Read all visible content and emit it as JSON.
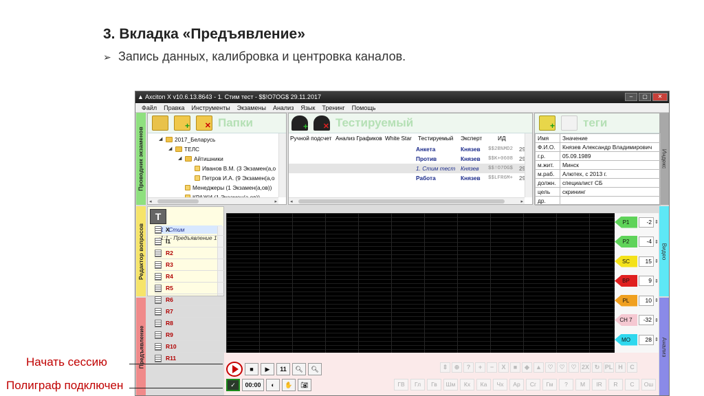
{
  "slide": {
    "title": "3. Вкладка «Предъявление»",
    "bullet": "Запись данных, калибровка и центровка каналов.",
    "bullet_marker": "➢"
  },
  "window": {
    "title": "Axciton X v10.6.13.8643 - 1. Стим тест - $$!O7OG$ 29.11.2017"
  },
  "menu": [
    "Файл",
    "Правка",
    "Инструменты",
    "Экзамены",
    "Анализ",
    "Язык",
    "Тренинг",
    "Помощь"
  ],
  "side_tabs": {
    "explorer": "Проводник экзаменов",
    "editor": "Редактор вопросов",
    "presentation": "Предъявление",
    "index": "Индекс",
    "video": "Видео",
    "analysis": "Анализ"
  },
  "folders_panel": {
    "title": "Папки",
    "tree": [
      {
        "label": "2017_Беларусь"
      },
      {
        "label": "ТЕЛС"
      },
      {
        "label": "Айтишники"
      },
      {
        "label": "Иванов В.М. (3 Экзамен(а,о"
      },
      {
        "label": "Петров И.А. (9 Экзамен(а,о"
      },
      {
        "label": "Менеджеры (1 Экзамен(а,ов))"
      },
      {
        "label": "КРАЖИ (1 Экзамен(а,ов))"
      }
    ]
  },
  "tested_panel": {
    "title": "Тестируемый",
    "columns": [
      "Ручной подсчет",
      "Анализ Графиков",
      "White Star",
      "Тестируемый",
      "Эксперт",
      "ИД"
    ],
    "rows": [
      {
        "name": "Анкета",
        "expert": "Князев",
        "id": "$$2B%MD2",
        "num": "29."
      },
      {
        "name": "Против",
        "expert": "Князев",
        "id": "$$K+0608",
        "num": "29."
      },
      {
        "name": "1. Стим тест",
        "expert": "Князев",
        "id": "$$!O7OG$",
        "num": "29."
      },
      {
        "name": "Работа",
        "expert": "Князев",
        "id": "$$LFR6M+",
        "num": "29."
      }
    ]
  },
  "tags_panel": {
    "title": "теги",
    "header": {
      "key": "Имя",
      "value": "Значение"
    },
    "rows": [
      {
        "key": "Ф.И.О.",
        "value": "Князев Александр Владимирович"
      },
      {
        "key": "г.р.",
        "value": "05.09.1989"
      },
      {
        "key": "м.жит.",
        "value": "Минск"
      },
      {
        "key": "м.раб.",
        "value": "Алютех, с 2013 г."
      },
      {
        "key": "должн.",
        "value": "специалист СБ"
      },
      {
        "key": "цель",
        "value": "скрининг"
      },
      {
        "key": "др.",
        "value": ""
      }
    ]
  },
  "question_editor": {
    "items": [
      "1 - Стим",
      "1:1 - Предъявление 1"
    ],
    "questions": [
      {
        "label": "X",
        "color": "#111111"
      },
      {
        "label": "I1",
        "color": "#111111"
      },
      {
        "label": "R2",
        "color": "#b00000"
      },
      {
        "label": "R3",
        "color": "#b00000"
      },
      {
        "label": "R4",
        "color": "#b00000"
      },
      {
        "label": "R5",
        "color": "#b00000"
      },
      {
        "label": "R6",
        "color": "#b00000"
      },
      {
        "label": "R7",
        "color": "#b00000"
      },
      {
        "label": "R8",
        "color": "#b00000"
      },
      {
        "label": "R9",
        "color": "#b00000"
      },
      {
        "label": "R10",
        "color": "#b00000"
      },
      {
        "label": "R11",
        "color": "#b00000"
      }
    ]
  },
  "channels": [
    {
      "name": "P1",
      "value": "-2",
      "color": "#5fd35a"
    },
    {
      "name": "P2",
      "value": "-4",
      "color": "#5fd35a"
    },
    {
      "name": "SC",
      "value": "15",
      "color": "#f4e21a"
    },
    {
      "name": "BP",
      "value": "9",
      "color": "#e02020"
    },
    {
      "name": "PL",
      "value": "10",
      "color": "#f0a020"
    },
    {
      "name": "CH 7",
      "value": "-32",
      "color": "#f5c8d2"
    },
    {
      "name": "MO",
      "value": "28",
      "color": "#2fd8ee"
    }
  ],
  "controls": {
    "record_count": "11",
    "timer": "00:00",
    "ghost_icons": [
      "⇕",
      "⊕",
      "?",
      "+",
      "−",
      "X",
      "■",
      "◆",
      "▲",
      "♡",
      "♡",
      "♡",
      "2X",
      "↻",
      "PL",
      "H",
      "C"
    ],
    "abbr_buttons": [
      "ГВ",
      "Гл",
      "Гв",
      "Шм",
      "Кх",
      "Ка",
      "Чх",
      "Ар",
      "Сг",
      "Гм",
      "?",
      "М",
      "IR",
      "R",
      "С",
      "Ош"
    ]
  },
  "callouts": {
    "start": "Начать сессию",
    "polygraph": "Полиграф подключен"
  }
}
